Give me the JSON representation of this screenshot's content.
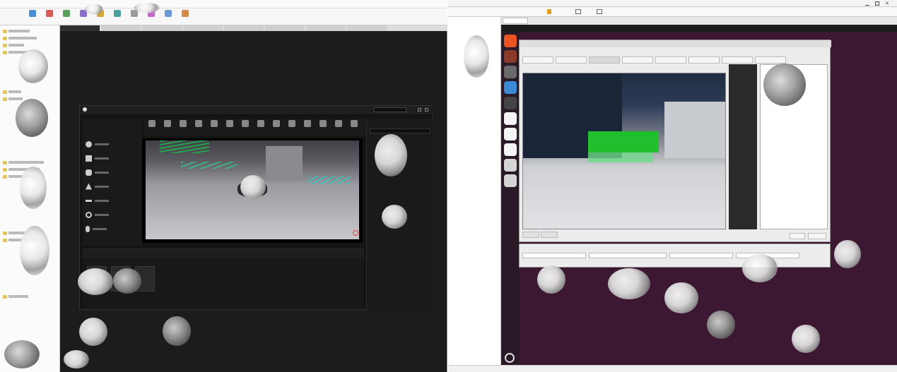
{
  "left_window": {
    "title": "",
    "toolbar": [
      {
        "label": "",
        "color": "#4a8fd6"
      },
      {
        "label": "",
        "color": "#d65a5a"
      },
      {
        "label": "",
        "color": "#5aa05a"
      },
      {
        "label": "",
        "color": "#8a6ad0"
      },
      {
        "label": "",
        "color": "#d4a73a"
      },
      {
        "label": "",
        "color": "#4aa0a0"
      },
      {
        "label": "",
        "color": "#9a9a9a"
      },
      {
        "label": "",
        "color": "#c46ac4"
      },
      {
        "label": "",
        "color": "#6a9ad4"
      },
      {
        "label": "",
        "color": "#d48a4a"
      }
    ],
    "tabs": [
      "",
      "",
      "",
      "",
      "",
      "",
      "",
      ""
    ],
    "terminal": {
      "lines": [
        {
          "pre": "",
          "hl": "",
          "post": "",
          "cls": ""
        },
        {
          "pre": "",
          "hl": "",
          "post": "",
          "cls": ""
        },
        {
          "pre": "",
          "hl": "",
          "post": "",
          "cls": ""
        },
        {
          "pre": "",
          "hl": "",
          "post": "",
          "cls": ""
        },
        {
          "pre": "",
          "hl": "",
          "post": "",
          "cls": ""
        },
        {
          "pre": "",
          "hl": "",
          "post": "",
          "cls": ""
        },
        {
          "pre": "",
          "hl": "",
          "post": "",
          "cls": ""
        },
        {
          "pre": "",
          "hl": "",
          "post": "",
          "cls": ""
        },
        {
          "pre": "",
          "hl": "",
          "post": "",
          "cls": ""
        },
        {
          "pre": "",
          "hl": "",
          "post": "",
          "cls": ""
        },
        {
          "pre": "",
          "hl": "",
          "post": "",
          "cls": ""
        },
        {
          "pre": "",
          "hl": "",
          "post": "",
          "cls": ""
        },
        {
          "pre": "",
          "hl": "",
          "post": "",
          "cls": ""
        },
        {
          "pre": "",
          "hl": "",
          "post": "",
          "cls": ""
        },
        {
          "pre": "",
          "hl": "",
          "post": "",
          "cls": ""
        }
      ]
    },
    "ue_editor": {
      "outliner_rows": [
        "",
        "",
        "",
        "",
        "",
        "",
        "",
        "",
        "",
        "",
        "",
        "",
        "",
        "",
        "",
        "",
        "",
        "",
        "",
        "",
        ""
      ],
      "content_browser_path": ""
    }
  },
  "right_window": {
    "title": "",
    "library_rows": [
      "",
      "",
      "",
      "",
      ""
    ],
    "dock_colors": [
      "#e95420",
      "#8a3a2a",
      "#6a6a6a",
      "#3a8ad4",
      "#444444",
      "#f4f4f4",
      "#f4f4f4",
      "#f4f4f4",
      "#d4d4d4",
      "#d4d4d4"
    ],
    "rqt": {
      "title": "",
      "menu": [
        "",
        "",
        ""
      ],
      "camera_buttons": [
        "",
        "",
        "",
        "",
        "",
        "",
        "",
        ""
      ],
      "image_label": "",
      "bottom_tabs": [
        "",
        ""
      ],
      "btn_a": "",
      "btn_b": ""
    },
    "rqt_panel": {
      "title": "",
      "fields": [
        "",
        "",
        "",
        ""
      ],
      "hint": ""
    },
    "terminal": {
      "lines": [
        "",
        "",
        "",
        "",
        "",
        "",
        "",
        "",
        "",
        "",
        "",
        "",
        "",
        ""
      ]
    }
  }
}
